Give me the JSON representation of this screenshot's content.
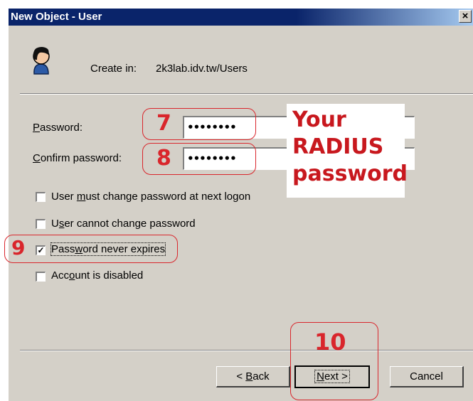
{
  "window": {
    "title": "New Object - User",
    "close_glyph": "×"
  },
  "header": {
    "create_in_label": "Create in:",
    "create_in_value": "2k3lab.idv.tw/Users",
    "icon": "user-icon"
  },
  "fields": {
    "password_label": "Password:",
    "password_value": "••••••••",
    "confirm_label": "Confirm password:",
    "confirm_value": "••••••••"
  },
  "checkboxes": [
    {
      "label": "User must change password at next logon",
      "checked": false
    },
    {
      "label": "User cannot change password",
      "checked": false
    },
    {
      "label": "Password never expires",
      "checked": true
    },
    {
      "label": "Account is disabled",
      "checked": false
    }
  ],
  "buttons": {
    "back": "< Back",
    "next": "Next >",
    "cancel": "Cancel"
  },
  "annotations": {
    "step_7": "7",
    "step_8": "8",
    "step_9": "9",
    "step_10": "10",
    "note_lines": [
      "Your",
      "RADIUS",
      "password"
    ],
    "color": "#d9262c"
  }
}
